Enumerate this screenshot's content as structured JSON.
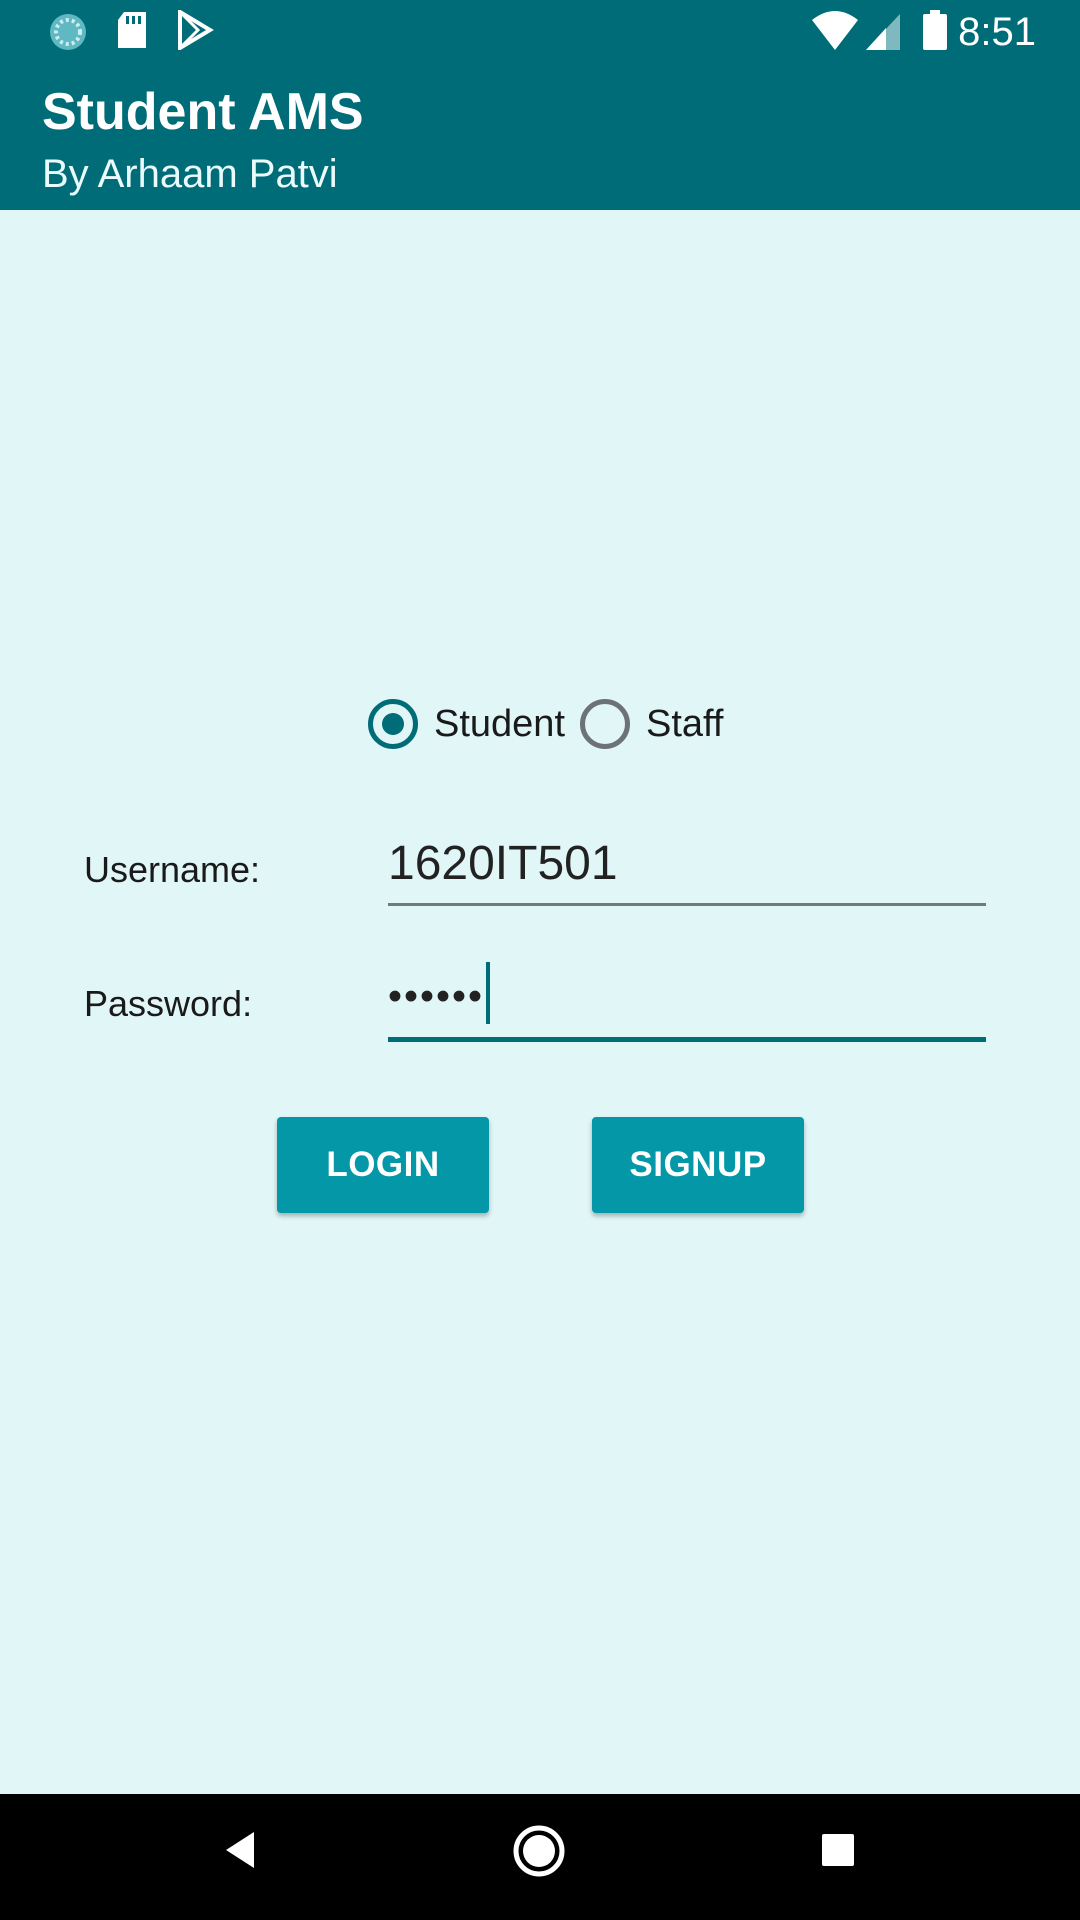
{
  "status_bar": {
    "time": "8:51",
    "left_icons": [
      "sync-icon",
      "sd-card-icon",
      "play-store-icon"
    ],
    "right_icons": [
      "wifi-icon",
      "cell-signal-icon",
      "battery-icon"
    ]
  },
  "app_bar": {
    "title": "Student AMS",
    "subtitle": "By Arhaam Patvi",
    "color": "#006c78"
  },
  "role_selector": {
    "options": [
      {
        "label": "Student",
        "checked": true
      },
      {
        "label": "Staff",
        "checked": false
      }
    ]
  },
  "form": {
    "username_label": "Username:",
    "username_value": "1620IT501",
    "password_label": "Password:",
    "password_value": "••••••"
  },
  "buttons": {
    "login_label": "LOGIN",
    "signup_label": "SIGNUP",
    "color": "#0397a8"
  },
  "nav_bar": {
    "icons": [
      "back-icon",
      "home-icon",
      "recents-icon"
    ]
  },
  "background_color": "#e0f6f7"
}
